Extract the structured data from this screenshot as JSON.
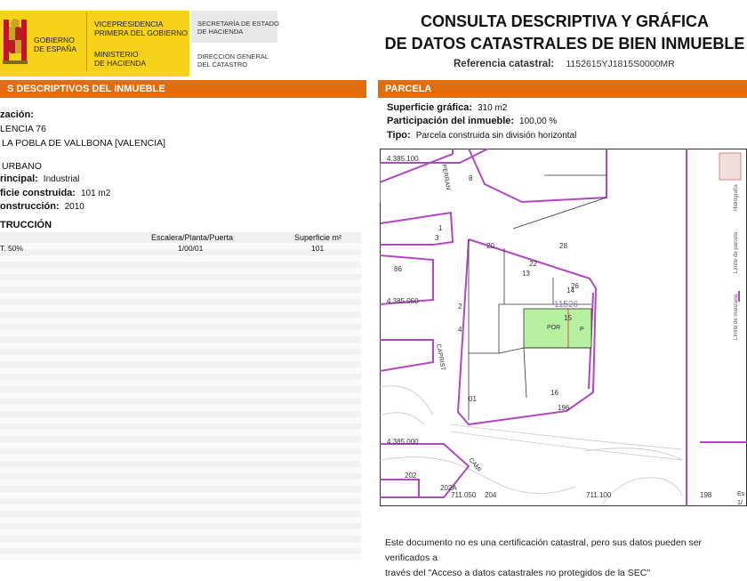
{
  "header": {
    "gov_line1": "GOBIERNO",
    "gov_line2": "DE ESPAÑA",
    "vice_line1": "VICEPRESIDENCIA",
    "vice_line2": "PRIMERA DEL GOBIERNO",
    "min_line1": "MINISTERIO",
    "min_line2": "DE HACIENDA",
    "sec_line1": "SECRETARÍA DE ESTADO",
    "sec_line2": "DE HACIENDA",
    "dir_line1": "DIRECCIÓN GENERAL",
    "dir_line2": "DEL CATASTRO",
    "title_line1": "CONSULTA DESCRIPTIVA Y GRÁFICA",
    "title_line2": "DE DATOS CATASTRALES DE BIEN INMUEBLE",
    "ref_label": "Referencia catastral:",
    "ref_value": "1152615YJ1815S0000MR"
  },
  "left": {
    "section_title": "S DESCRIPTIVOS DEL INMUEBLE",
    "loc_label": "zación:",
    "loc_line1": "LENCIA 76",
    "loc_line2": "LA POBLA DE VALLBONA [VALENCIA]",
    "class_value": "URBANO",
    "uso_label": "rincipal:",
    "uso_value": "Industrial",
    "sup_label": "ficie construida:",
    "sup_value": "101 m2",
    "anio_label": "onstrucción:",
    "anio_value": "2010",
    "constr_title": "TRUCCIÓN",
    "table": {
      "headers": [
        "Escalera/Planta/Puerta",
        "Superficie m²"
      ],
      "rows": [
        [
          "T. 50%",
          "1/00/01",
          "101"
        ]
      ]
    }
  },
  "right": {
    "section_title": "PARCELA",
    "sg_label": "Superficie gráfica:",
    "sg_value": "310 m2",
    "part_label": "Participación del inmueble:",
    "part_value": "100,00 %",
    "tipo_label": "Tipo:",
    "tipo_value": "Parcela construida sin división horizontal",
    "map": {
      "coord_y1": "4.385.100",
      "coord_y2": "4.385.050",
      "coord_y3": "4.385.000",
      "coord_x1": "711.050",
      "coord_x2": "711.100",
      "parcel_id": "11526",
      "labels": [
        "13",
        "14",
        "15",
        "16",
        "01",
        "20",
        "22",
        "26",
        "28",
        "196",
        "198",
        "202",
        "202A",
        "204",
        "1",
        "3",
        "4",
        "2",
        "8",
        "POR",
        "P",
        "CAMI",
        "PERRAN",
        "CAPRIST",
        "86",
        "Es",
        "1/"
      ],
      "legend": [
        "Hidrografía",
        "Límite de parcela",
        "Límite de manzana"
      ]
    },
    "note_line1": "Este documento no es una certificación catastral, pero sus datos pueden ser verificados a",
    "note_line2": "través del \"Acceso a datos catastrales no protegidos de la SEC\""
  }
}
